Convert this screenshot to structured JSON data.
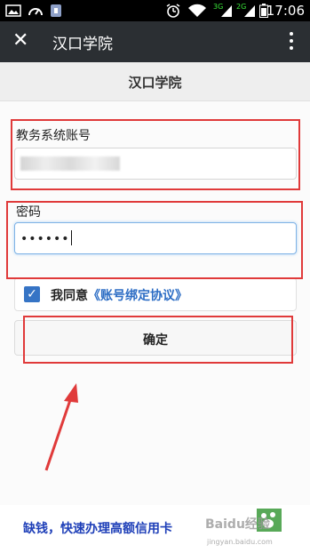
{
  "status_bar": {
    "time": "17:06",
    "network_label_1": "3G",
    "network_label_2": "2G",
    "icons": [
      "image-icon",
      "gauge-icon",
      "sim-icon",
      "alarm-icon",
      "wifi-icon",
      "signal-icon",
      "battery-icon"
    ]
  },
  "app_bar": {
    "close_glyph": "✕",
    "title": "汉口学院",
    "menu_icon": "more-vert-icon"
  },
  "page": {
    "title": "汉口学院"
  },
  "form": {
    "account_label": "教务系统账号",
    "account_value": "",
    "password_label": "密码",
    "password_value": "••••••",
    "agree_checked": true,
    "agree_prefix": "我同意",
    "agree_link": "《账号绑定协议》",
    "confirm_label": "确定"
  },
  "ad": {
    "text": "缺钱，快速办理高额信用卡",
    "watermark_text": "Baidu经验",
    "watermark_sub": "jingyan.baidu.com"
  },
  "colors": {
    "annotation": "#e03a3a",
    "app_bar": "#2b2f33",
    "link": "#2b6cc4",
    "checkbox": "#3674c5"
  }
}
